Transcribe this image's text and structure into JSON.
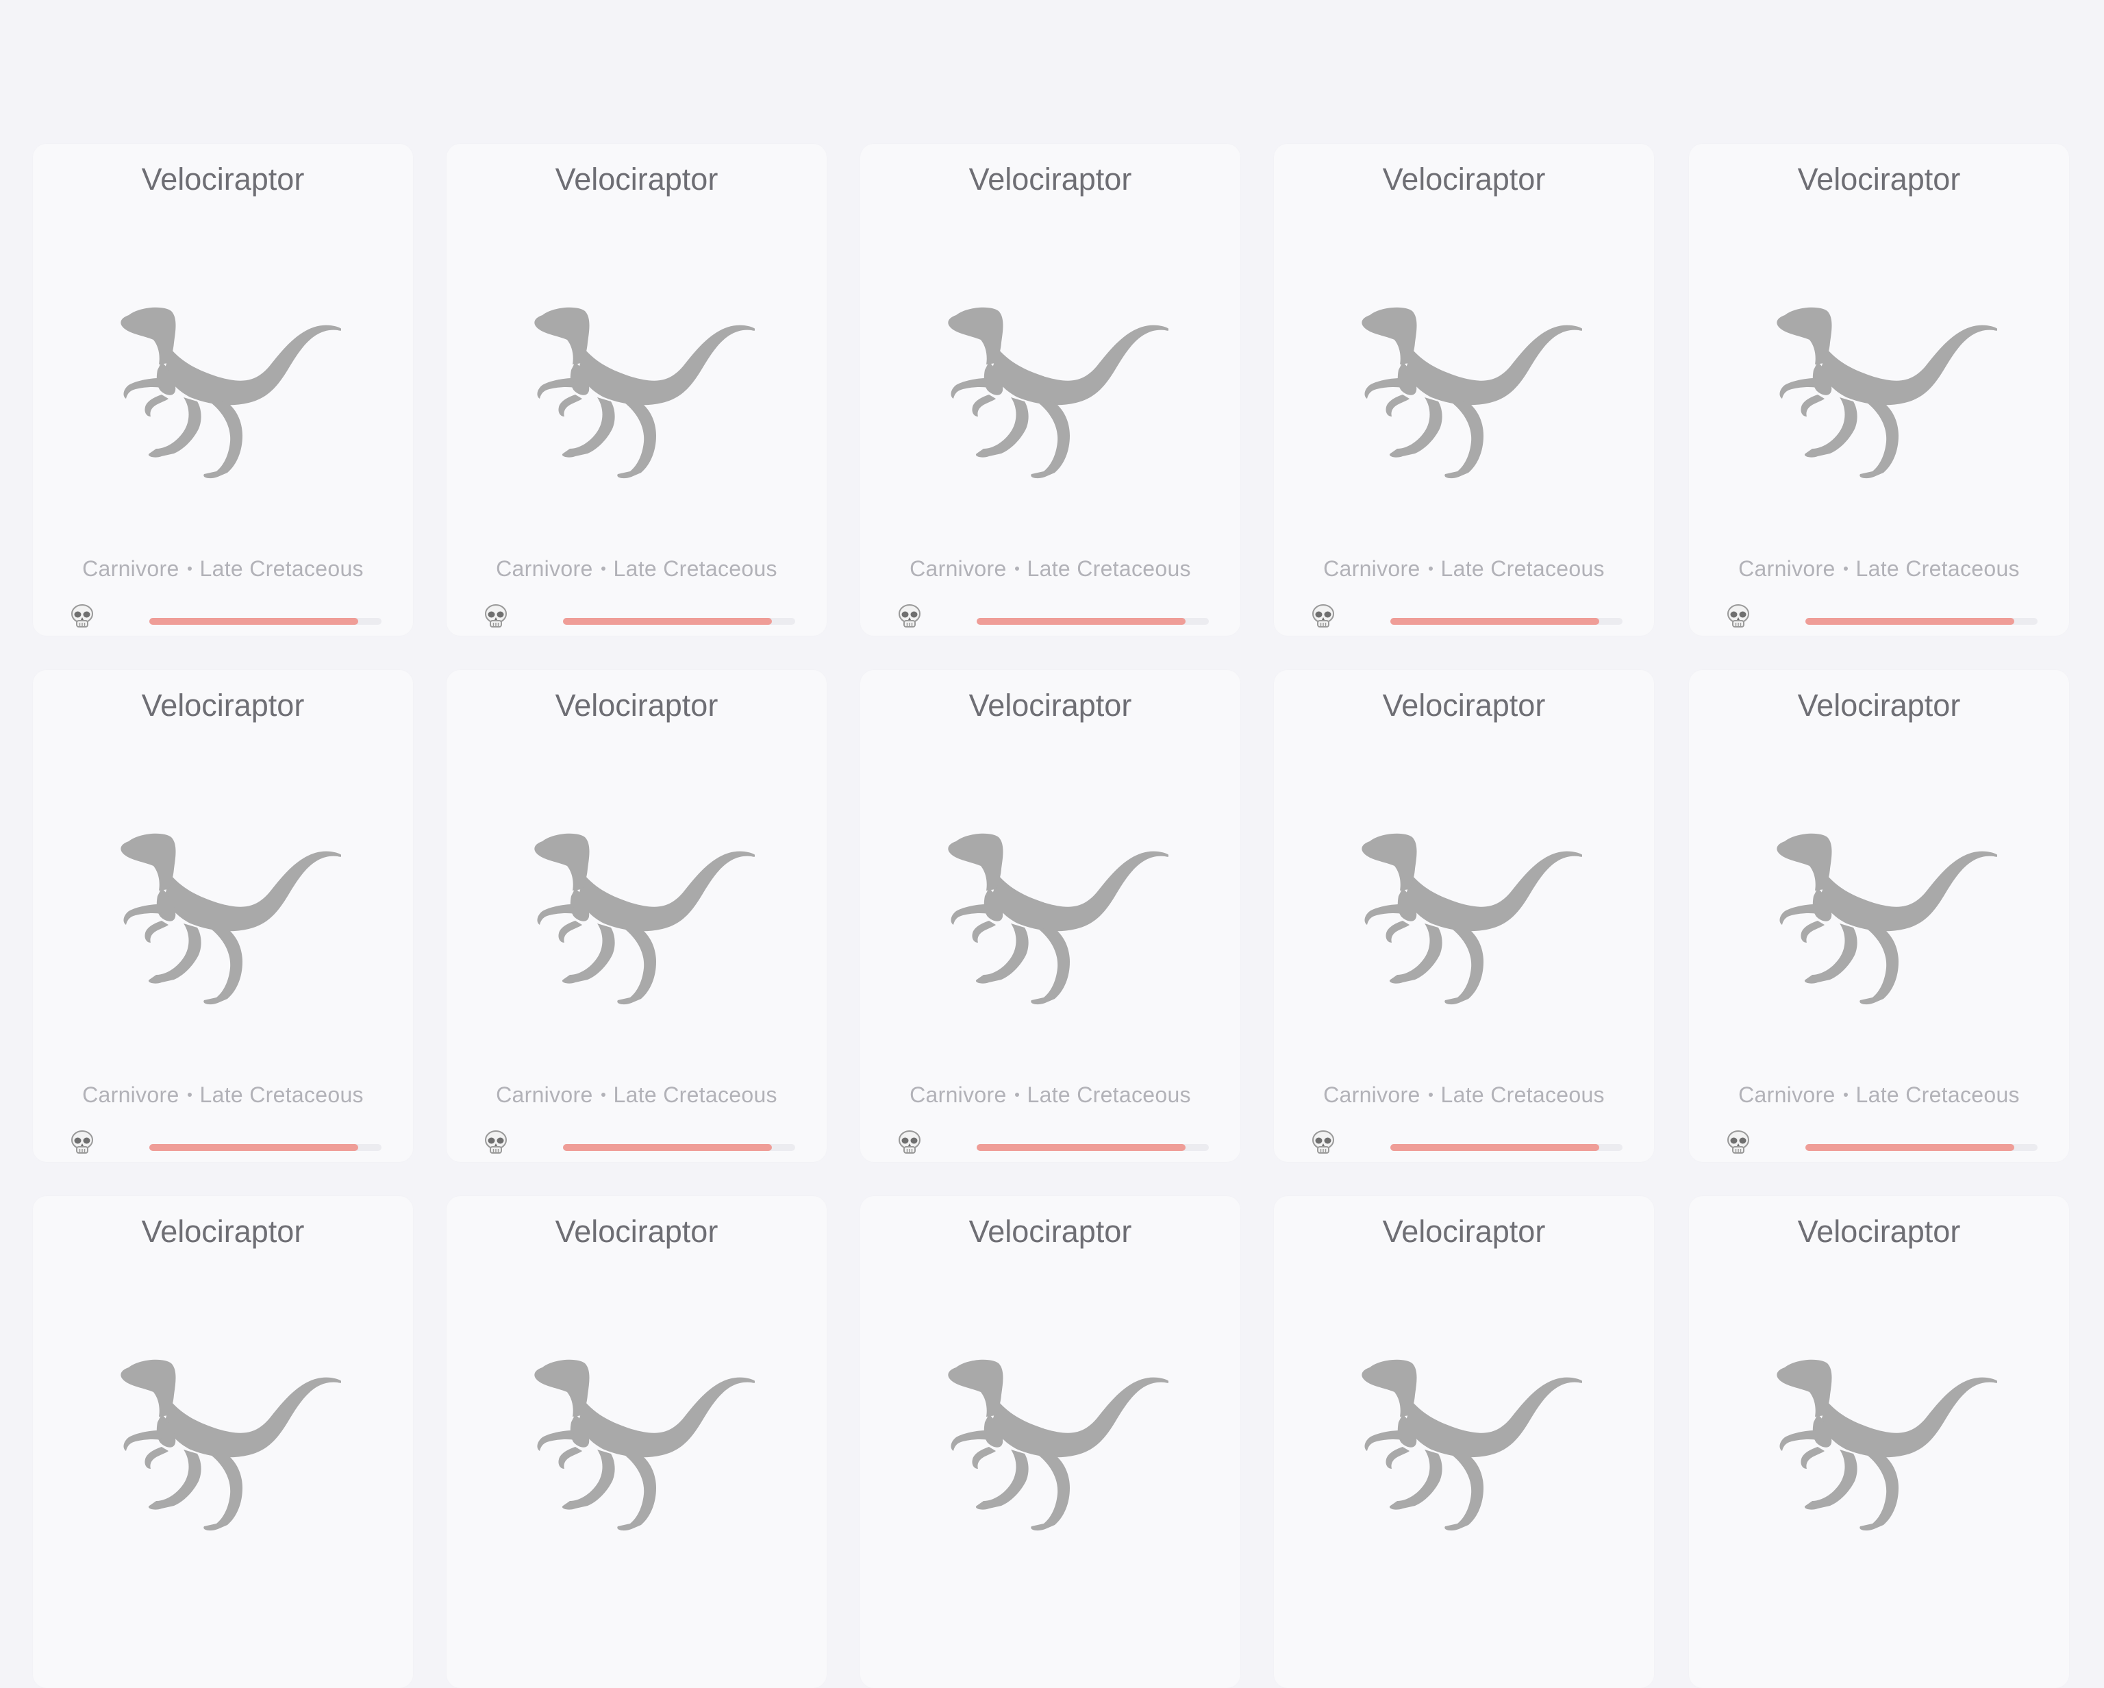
{
  "cards": [
    {
      "name": "Velociraptor",
      "diet": "Carnivore",
      "period": "Late Cretaceous",
      "status_icon": "skull-icon",
      "extinction_level": 0.9
    },
    {
      "name": "Velociraptor",
      "diet": "Carnivore",
      "period": "Late Cretaceous",
      "status_icon": "skull-icon",
      "extinction_level": 0.9
    },
    {
      "name": "Velociraptor",
      "diet": "Carnivore",
      "period": "Late Cretaceous",
      "status_icon": "skull-icon",
      "extinction_level": 0.9
    },
    {
      "name": "Velociraptor",
      "diet": "Carnivore",
      "period": "Late Cretaceous",
      "status_icon": "skull-icon",
      "extinction_level": 0.9
    },
    {
      "name": "Velociraptor",
      "diet": "Carnivore",
      "period": "Late Cretaceous",
      "status_icon": "skull-icon",
      "extinction_level": 0.9
    },
    {
      "name": "Velociraptor",
      "diet": "Carnivore",
      "period": "Late Cretaceous",
      "status_icon": "skull-icon",
      "extinction_level": 0.9
    },
    {
      "name": "Velociraptor",
      "diet": "Carnivore",
      "period": "Late Cretaceous",
      "status_icon": "skull-icon",
      "extinction_level": 0.9
    },
    {
      "name": "Velociraptor",
      "diet": "Carnivore",
      "period": "Late Cretaceous",
      "status_icon": "skull-icon",
      "extinction_level": 0.9
    },
    {
      "name": "Velociraptor",
      "diet": "Carnivore",
      "period": "Late Cretaceous",
      "status_icon": "skull-icon",
      "extinction_level": 0.9
    },
    {
      "name": "Velociraptor",
      "diet": "Carnivore",
      "period": "Late Cretaceous",
      "status_icon": "skull-icon",
      "extinction_level": 0.9
    },
    {
      "name": "Velociraptor",
      "diet": "",
      "period": "",
      "status_icon": "",
      "extinction_level": null
    },
    {
      "name": "Velociraptor",
      "diet": "",
      "period": "",
      "status_icon": "",
      "extinction_level": null
    },
    {
      "name": "Velociraptor",
      "diet": "",
      "period": "",
      "status_icon": "",
      "extinction_level": null
    },
    {
      "name": "Velociraptor",
      "diet": "",
      "period": "",
      "status_icon": "",
      "extinction_level": null
    },
    {
      "name": "Velociraptor",
      "diet": "",
      "period": "",
      "status_icon": "",
      "extinction_level": null
    }
  ],
  "colors": {
    "page_background": "#f4f4f8",
    "card_background": "#f9f9fb",
    "silhouette": "#a9a9a9",
    "bar_fill": "#ef9d97",
    "bar_track": "#ececf0"
  },
  "silhouette_icon": "velociraptor-silhouette-icon"
}
